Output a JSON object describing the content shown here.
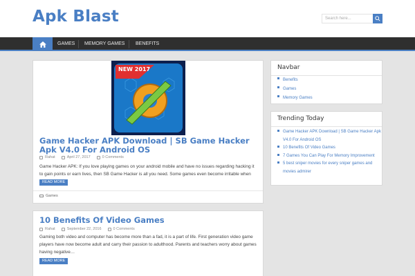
{
  "site": {
    "title": "Apk Blast"
  },
  "search": {
    "placeholder": "Search here..."
  },
  "nav": {
    "items": [
      "Games",
      "Memory Games",
      "Benefits"
    ]
  },
  "posts": [
    {
      "title": "Game Hacker APK Download | SB Game Hacker Apk V4.0 For Android OS",
      "author": "Rahat",
      "date": "April 27, 2017",
      "comments": "0 Comments",
      "excerpt": "Game Hacker APK: If you love playing games on your android mobile and have no issues regarding hacking it to gain points or earn lives, then SB Game Hacker is all you need. Some games even become irritable when it…",
      "read_more": "READ MORE",
      "category": "Games",
      "thumb_badge": "NEW 2017"
    },
    {
      "title": "10 Benefits Of Video Games",
      "author": "Rahat",
      "date": "September 22, 2016",
      "comments": "0 Comments",
      "excerpt": "Gaming both video and computer has become more than a fad, it is a part of life. First generation video game players have now become adult and carry their passion to adulthood. Parents and teachers worry about games having negative…",
      "read_more": "READ MORE"
    }
  ],
  "sidebar": {
    "navbar": {
      "title": "Navbar",
      "items": [
        "Benefits",
        "Games",
        "Memory Games"
      ]
    },
    "trending": {
      "title": "Trending Today",
      "items": [
        "Game Hacker APK Download | SB Game Hacker Apk V4.0 For Android OS",
        "10 Benefits Of Video Games",
        "7 Games You Can Play For Memory Improvement",
        "5 best sniper movies for every sniper games and movies admirer"
      ]
    }
  },
  "colors": {
    "accent": "#4a7fc4",
    "nav_bg": "#2f2f2f",
    "page_bg": "#e4e4e4"
  }
}
